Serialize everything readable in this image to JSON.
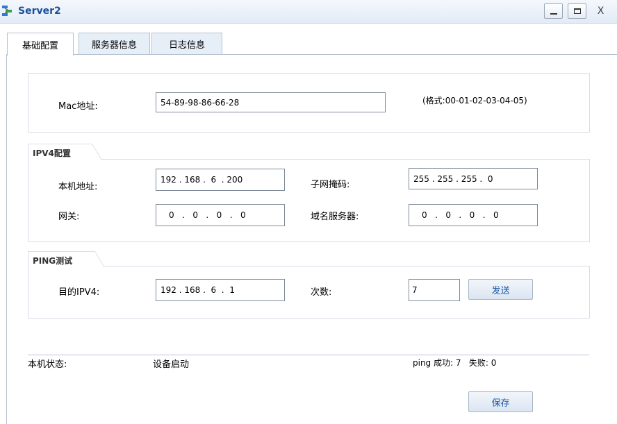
{
  "window": {
    "title": "Server2",
    "minimize": "_",
    "maximize": "",
    "close": "X"
  },
  "tabs": [
    {
      "label": "基础配置",
      "active": true
    },
    {
      "label": "服务器信息",
      "active": false
    },
    {
      "label": "日志信息",
      "active": false
    }
  ],
  "mac": {
    "label": "Mac地址:",
    "value": "54-89-98-86-66-28",
    "hint": "(格式:00-01-02-03-04-05)"
  },
  "ipv4": {
    "title": "IPV4配置",
    "local_label": "本机地址:",
    "local_value": "192 . 168 .  6  . 200",
    "mask_label": "子网掩码:",
    "mask_value": "255 . 255 . 255 .  0",
    "gateway_label": "网关:",
    "gateway_value": "0   .   0   .   0   .   0",
    "dns_label": "域名服务器:",
    "dns_value": "0   .   0   .   0   .   0"
  },
  "ping": {
    "title": "PING测试",
    "dest_label": "目的IPV4:",
    "dest_value": "192 . 168 .  6  .  1",
    "count_label": "次数:",
    "count_value": "7",
    "send_label": "发送"
  },
  "status": {
    "label": "本机状态:",
    "value": "设备启动",
    "ping_result": "ping 成功: 7   失败: 0"
  },
  "save_label": "保存",
  "colors": {
    "title": "#1b4f9c",
    "button_text": "#1f5aa6",
    "border": "#d6dde6"
  }
}
